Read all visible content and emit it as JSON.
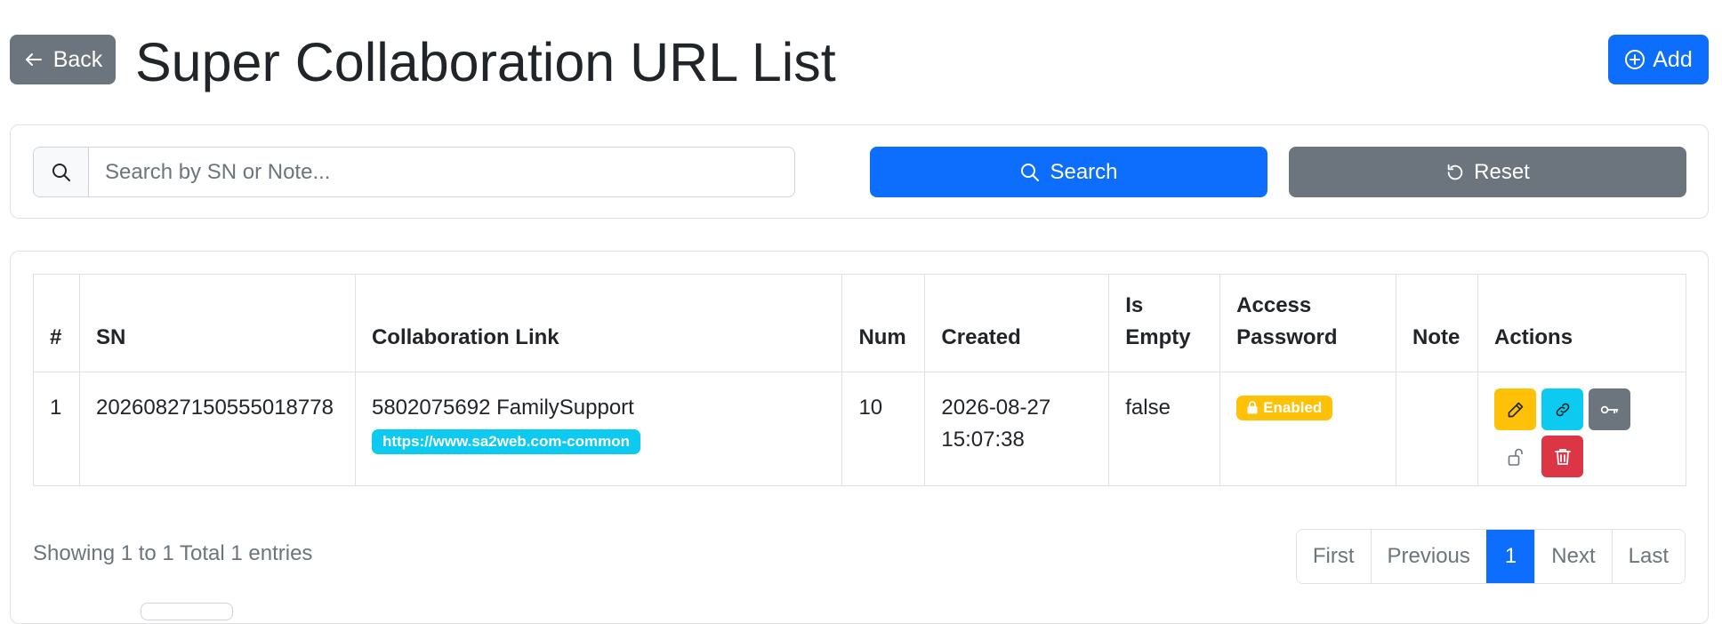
{
  "header": {
    "back_label": "Back",
    "title": "Super Collaboration URL List",
    "add_label": "Add"
  },
  "search": {
    "placeholder": "Search by SN or Note...",
    "value": "",
    "search_label": "Search",
    "reset_label": "Reset"
  },
  "table": {
    "columns": [
      "#",
      "SN",
      "Collaboration Link",
      "Num",
      "Created",
      "Is Empty",
      "Access Password",
      "Note",
      "Actions"
    ],
    "rows": [
      {
        "index": "1",
        "sn": "20260827150555018778",
        "link_name": "5802075692 FamilySupport",
        "link_url": "https://www.sa2web.com-common",
        "num": "10",
        "created": "2026-08-27 15:07:38",
        "is_empty": "false",
        "access_password": "Enabled",
        "note": "",
        "actions": [
          "pencil-icon",
          "link-icon",
          "key-icon",
          "unlock-icon",
          "trash-icon"
        ]
      }
    ]
  },
  "footer": {
    "entries_text": "Showing 1 to 1 Total 1 entries",
    "pagination": [
      "First",
      "Previous",
      "1",
      "Next",
      "Last"
    ],
    "current_page": "1"
  },
  "colors": {
    "primary": "#0d6efd",
    "secondary": "#6c757d",
    "info": "#0dcaf0",
    "warning": "#ffc107",
    "danger": "#dc3545"
  }
}
